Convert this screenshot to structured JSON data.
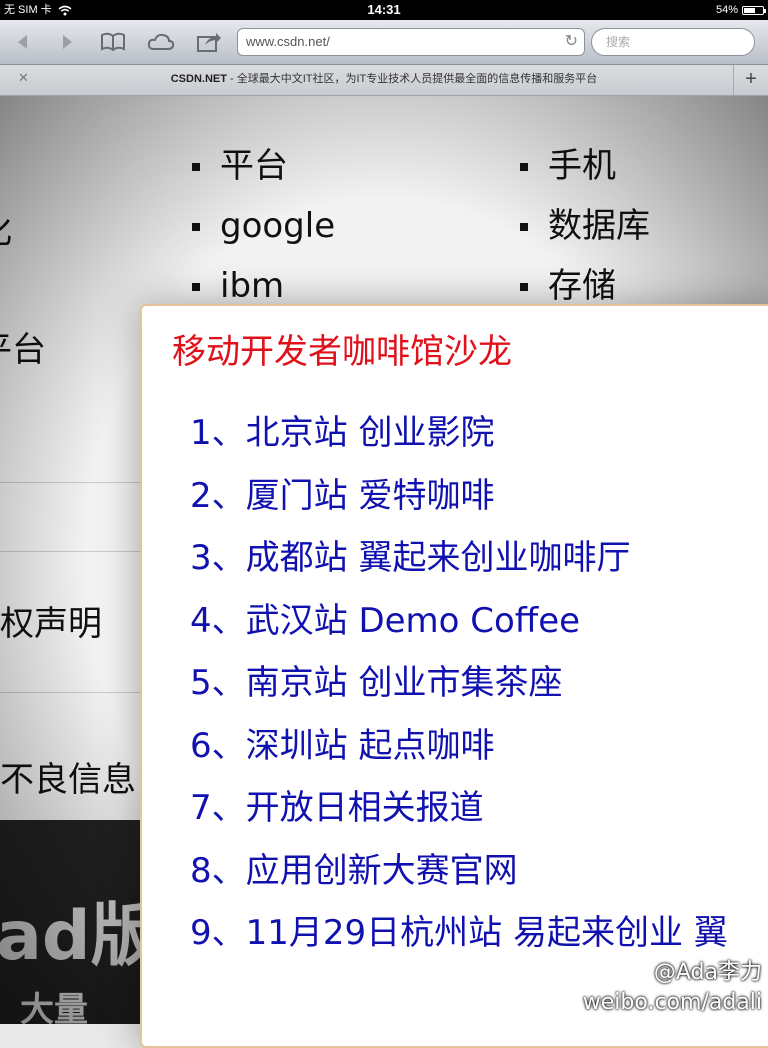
{
  "status_bar": {
    "carrier": "无 SIM 卡",
    "time": "14:31",
    "battery_percent": "54%",
    "battery_level": 0.54
  },
  "toolbar": {
    "url": "www.csdn.net/",
    "search_placeholder": "搜索"
  },
  "tab": {
    "site": "CSDN.NET",
    "title_rest": " - 全球最大中文IT社区，为IT专业技术人员提供最全面的信息传播和服务平台",
    "add_label": "+"
  },
  "page": {
    "list_col1": [
      "平台",
      "google",
      "ibm"
    ],
    "list_col2": [
      "手机",
      "数据库",
      "存储"
    ],
    "left_fragments": [
      "化",
      "平台",
      "权声明",
      "不良信息"
    ],
    "dark_fragment": "ad版",
    "dark_fragment_small": "大量"
  },
  "popup": {
    "title": "移动开发者咖啡馆沙龙",
    "items": [
      "1、北京站 创业影院",
      "2、厦门站 爱特咖啡",
      "3、成都站 翼起来创业咖啡厅",
      "4、武汉站 Demo Coffee",
      "5、南京站 创业市集茶座",
      "6、深圳站 起点咖啡",
      "7、开放日相关报道",
      "8、应用创新大赛官网",
      "9、11月29日杭州站 易起来创业 翼"
    ]
  },
  "watermark": {
    "handle": "@Ada李力",
    "url": "weibo.com/adali"
  }
}
